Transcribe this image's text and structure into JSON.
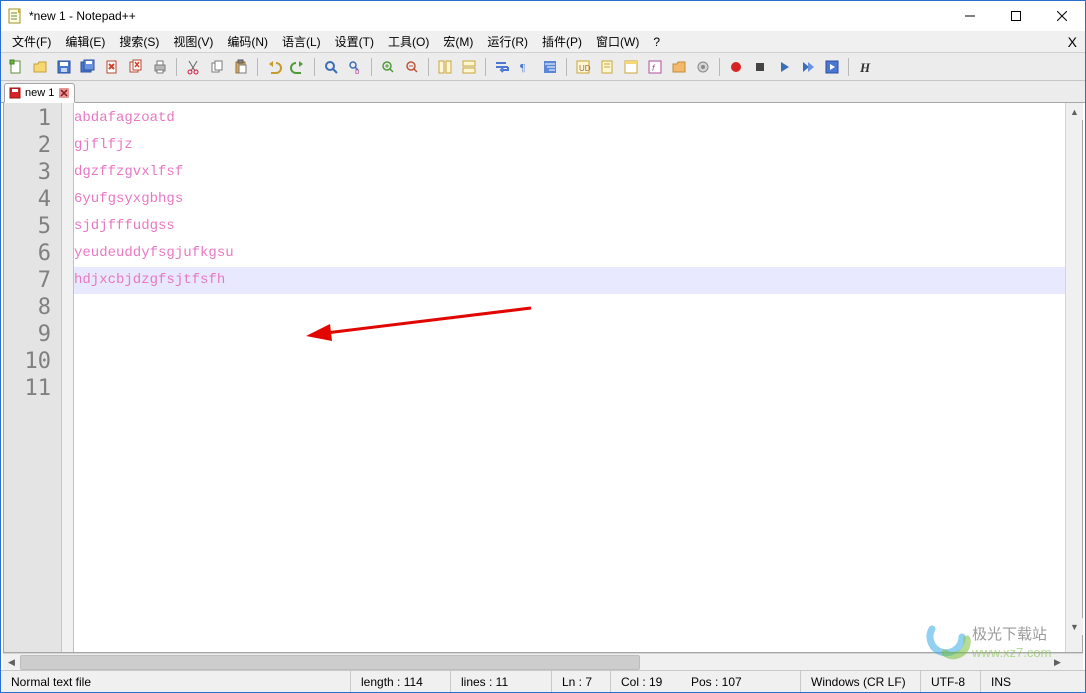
{
  "window": {
    "title": "*new 1 - Notepad++",
    "menu_close": "X"
  },
  "menus": [
    "文件(F)",
    "编辑(E)",
    "搜索(S)",
    "视图(V)",
    "编码(N)",
    "语言(L)",
    "设置(T)",
    "工具(O)",
    "宏(M)",
    "运行(R)",
    "插件(P)",
    "窗口(W)",
    "?"
  ],
  "toolbar_icons": [
    "new-file-icon",
    "open-file-icon",
    "save-icon",
    "save-all-icon",
    "close-icon",
    "close-all-icon",
    "print-icon",
    "cut-icon",
    "copy-icon",
    "paste-icon",
    "undo-icon",
    "redo-icon",
    "find-icon",
    "replace-icon",
    "zoom-in-icon",
    "zoom-out-icon",
    "sync-v-icon",
    "sync-h-icon",
    "wrap-icon",
    "all-chars-icon",
    "indent-guide-icon",
    "lang-icon",
    "doc-map-icon",
    "func-list-icon",
    "folder-icon",
    "monitor-icon",
    "record-icon",
    "stop-icon",
    "play-icon",
    "play-multi-icon",
    "save-macro-icon",
    "bold-h-icon"
  ],
  "tab": {
    "label": "new 1"
  },
  "editor": {
    "line_numbers": [
      "1",
      "2",
      "3",
      "4",
      "5",
      "6",
      "7",
      "8",
      "9",
      "10",
      "11"
    ],
    "lines": [
      "abdafagzoatd",
      "gjflfjz",
      "dgzffzgvxlfsf",
      "6yufgsyxgbhgs",
      "sjdjfffudgss",
      "yeudeuddyfsgjufkgsu",
      "hdjxcbjdzgfsjtfsfh",
      "",
      "",
      "",
      ""
    ],
    "current_line_index": 6
  },
  "status": {
    "file_type": "Normal text file",
    "length": "length : 114",
    "lines": "lines : 11",
    "ln": "Ln : 7",
    "col": "Col : 19",
    "pos": "Pos : 107",
    "eol": "Windows (CR LF)",
    "encoding": "UTF-8",
    "mode": "INS"
  },
  "watermark": {
    "line1": "极光下载站",
    "line2": "www.xz7.com"
  }
}
